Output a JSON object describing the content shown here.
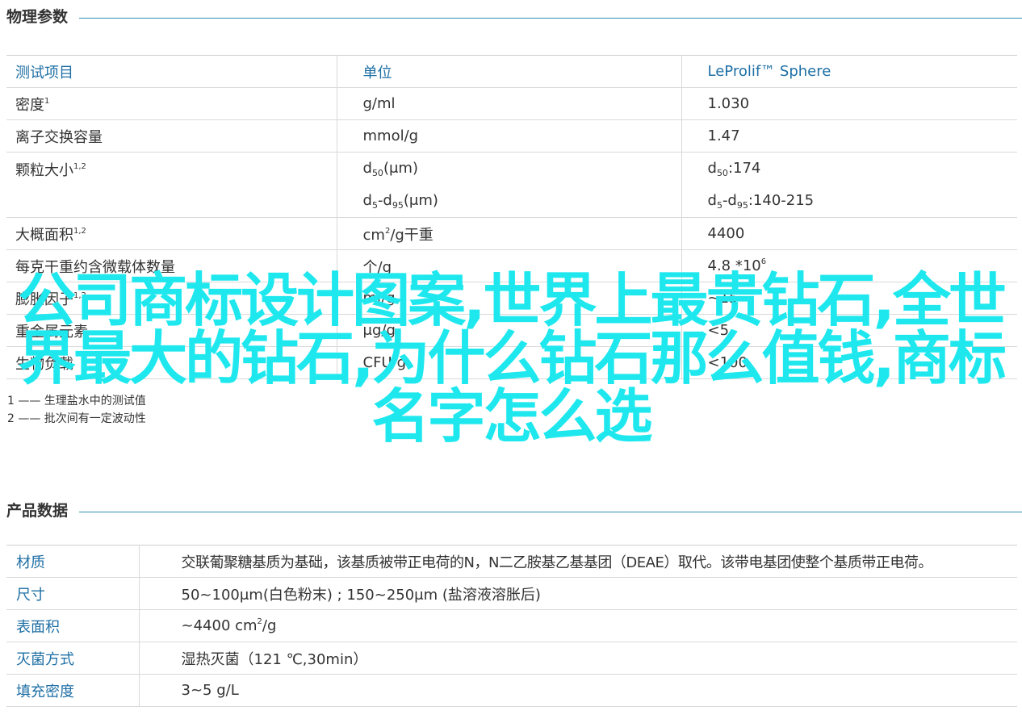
{
  "physical": {
    "title": "物理参数",
    "headers": [
      "测试项目",
      "单位",
      "LeProlif™ Sphere"
    ],
    "rows": [
      {
        "item": "密度",
        "sup": "1",
        "unit": "g/ml",
        "value": "1.030"
      },
      {
        "item": "离子交换容量",
        "sup": "",
        "unit": "mmol/g",
        "value": "1.47"
      },
      {
        "item": "颗粒大小",
        "sup": "1,2",
        "unit1_pre": "d",
        "unit1_sub": "50",
        "unit1_post": "(μm)",
        "unit2_pre": "d",
        "unit2_sub": "5",
        "unit2_mid": "-d",
        "unit2_sub2": "95",
        "unit2_post": "(μm)",
        "value1_pre": "d",
        "value1_sub": "50",
        "value1_post": ":174",
        "value2_pre": "d",
        "value2_sub": "5",
        "value2_mid": "-d",
        "value2_sub2": "95",
        "value2_post": ":140-215"
      },
      {
        "item": "大概面积",
        "sup": "1,2",
        "unit_pre": "cm",
        "unit_sup": "2",
        "unit_post": "/g干重",
        "value": "4400"
      },
      {
        "item": "每克干重约含微载体数量",
        "sup": "",
        "unit": "个/g",
        "value_pre": "4.8 *10",
        "value_sup": "6"
      },
      {
        "item": "膨胀因子",
        "sup": "1,2",
        "unit": "ml/g",
        "value": "~15"
      },
      {
        "item": "重金属元素",
        "sup": "",
        "unit": "μg/g",
        "value": "<5"
      },
      {
        "item": "生物负载",
        "sup": "",
        "unit": "CFU/g",
        "value": "<100"
      }
    ],
    "footnotes": [
      "1 —— 生理盐水中的测试值",
      "2 —— 批次间有一定波动性"
    ]
  },
  "overlay_text": "公司商标设计图案,世界上最贵钻石,全世界最大的钻石,为什么钻石那么值钱,商标名字怎么选",
  "product": {
    "title": "产品数据",
    "rows": [
      {
        "label": "材质",
        "value": "交联葡聚糖基质为基础，该基质被带正电荷的N，N二乙胺基乙基基团（DEAE）取代。该带电基团使整个基质带正电荷。"
      },
      {
        "label": "尺寸",
        "value": "50~100μm(白色粉末) ; 150~250μm (盐溶液溶胀后)"
      },
      {
        "label": "表面积",
        "value_pre": "~4400 cm",
        "value_sup": "2",
        "value_post": "/g"
      },
      {
        "label": "灭菌方式",
        "value": "湿热灭菌（121 ℃,30min）"
      },
      {
        "label": "填充密度",
        "value": "3~5 g/L"
      }
    ]
  },
  "colors": {
    "accent": "#1e6fa5",
    "rule": "#2e8fb5",
    "overlay": "#1ee8ee"
  }
}
